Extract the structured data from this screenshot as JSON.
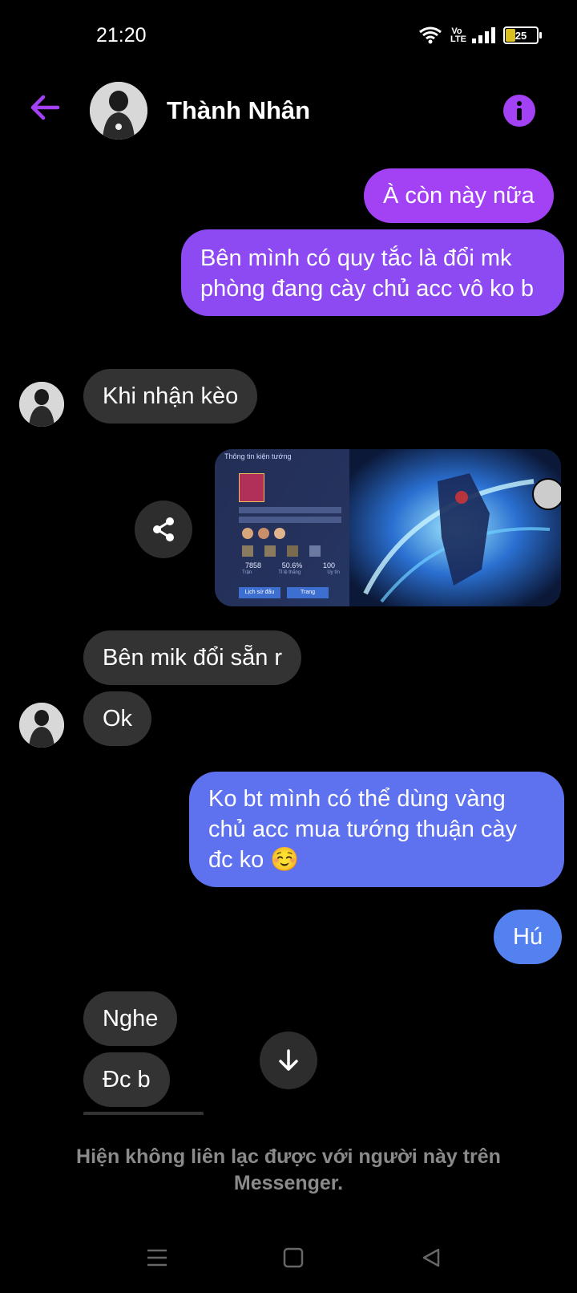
{
  "status_bar": {
    "time": "21:20",
    "network": "Vo LTE",
    "battery": "25"
  },
  "header": {
    "contact_name": "Thành Nhân"
  },
  "messages": [
    {
      "text": "À còn này nữa"
    },
    {
      "text": "Bên mình có quy tắc là đổi mk phòng đang cày chủ acc vô ko b"
    },
    {
      "text": "Khi nhận kèo"
    },
    {
      "text": "Bên mik đổi sẵn r"
    },
    {
      "text": "Ok"
    },
    {
      "text": "Ko bt mình có thể dùng vàng chủ acc mua tướng thuận cày đc ko ☺️"
    },
    {
      "text": "Hú"
    },
    {
      "text": "Nghe"
    },
    {
      "text": "Đc b"
    }
  ],
  "game_screenshot": {
    "title": "Thông tin kiện tướng",
    "stats": [
      "7858",
      "50.6%",
      "100"
    ],
    "stat_labels": [
      "Trận",
      "Tỉ lệ thắng",
      "Uy tín"
    ],
    "buttons": [
      "Lịch sử đấu",
      "Trang"
    ]
  },
  "footer": {
    "notice": "Hiện không liên lạc được với người này trên Messenger."
  },
  "colors": {
    "accent": "#a342f5",
    "incoming_bubble": "#333333",
    "outgoing_gradient": [
      "#a342f5",
      "#5382f0"
    ]
  }
}
